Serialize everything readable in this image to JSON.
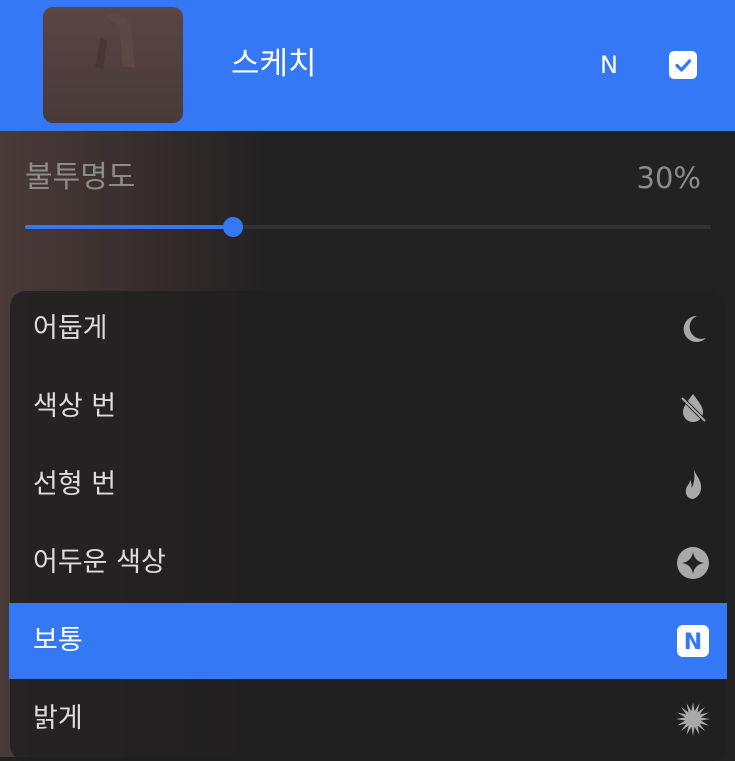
{
  "layer": {
    "name": "스케치",
    "blend_mode_letter": "N",
    "visible": true,
    "thumbnail_icon": "layer-thumbnail"
  },
  "opacity": {
    "label": "불투명도",
    "value_text": "30%",
    "value": 0.3
  },
  "blend_modes": [
    {
      "label": "어둡게",
      "icon": "moon-icon",
      "selected": false
    },
    {
      "label": "색상 번",
      "icon": "drop-slash-icon",
      "selected": false
    },
    {
      "label": "선형 번",
      "icon": "flame-icon",
      "selected": false
    },
    {
      "label": "어두운 색상",
      "icon": "sparkle-circle-icon",
      "selected": false
    },
    {
      "label": "보통",
      "icon": "normal-n-icon",
      "icon_letter": "N",
      "selected": true
    },
    {
      "label": "밝게",
      "icon": "starburst-icon",
      "selected": false
    }
  ],
  "colors": {
    "accent": "#3478f6",
    "panel": "#212021",
    "label_dim": "#8d8b8c",
    "item_text": "#dcdcdc",
    "icon_gray": "#a9a9a9"
  }
}
